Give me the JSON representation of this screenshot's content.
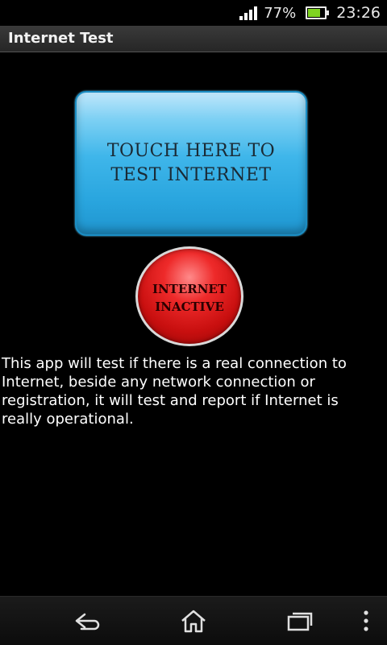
{
  "status_bar": {
    "battery_percent": "77%",
    "time": "23:26",
    "icons": [
      "signal-icon",
      "battery-icon"
    ],
    "battery_color": "#7fd321"
  },
  "app": {
    "title": "Internet Test"
  },
  "test_button": {
    "line1": "TOUCH HERE TO",
    "line2": "TEST INTERNET",
    "color": "#2aa6df"
  },
  "status_indicator": {
    "line1": "INTERNET",
    "line2": "INACTIVE",
    "color": "#d81414"
  },
  "description": "This app will test if there is a real connection to Internet, beside any network connection or registration, it will test and report if Internet is really operational.",
  "nav_bar": {
    "buttons": [
      "back-icon",
      "home-icon",
      "recent-apps-icon",
      "menu-icon"
    ]
  }
}
